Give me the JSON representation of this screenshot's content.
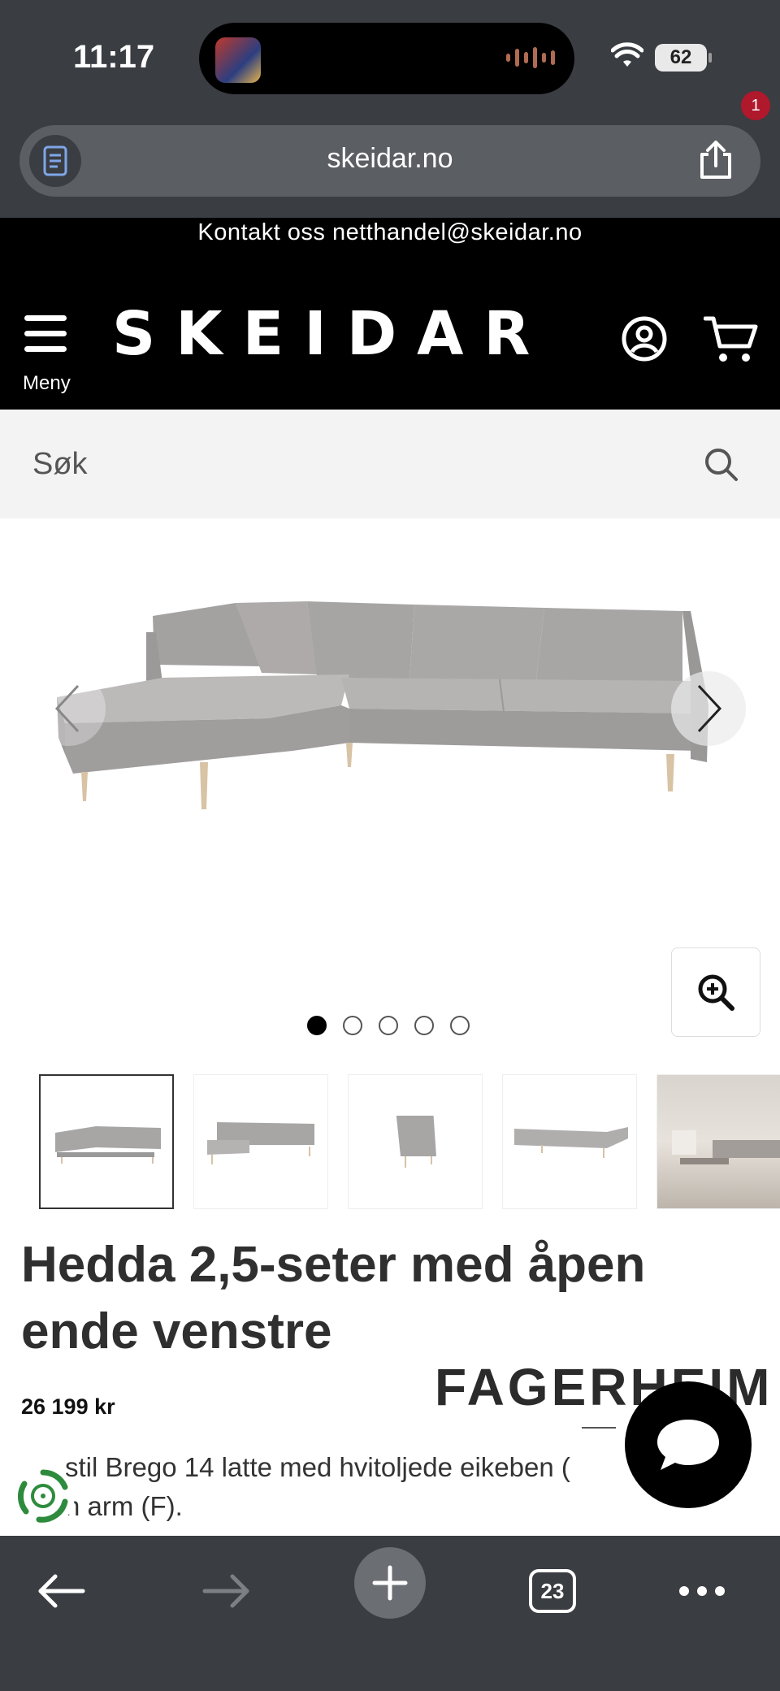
{
  "status": {
    "time": "11:17",
    "battery": "62"
  },
  "browser": {
    "url": "skeidar.no",
    "tabs_count": "23"
  },
  "header": {
    "contact_text": "Kontakt oss netthandel@skeidar.no",
    "menu_label": "Meny",
    "logo": "SKEIDAR",
    "cart_count": "1"
  },
  "search": {
    "placeholder": "Søk"
  },
  "gallery": {
    "image_count": 5,
    "active_index": 0
  },
  "product": {
    "title": "Hedda 2,5-seter med åpen ende venstre",
    "price": "26 199 kr",
    "brand": "FAGERHEIM",
    "description": "stil Brego 14 latte med hvitoljede eikeben (",
    "description2": "n arm (F)."
  },
  "colors": {
    "accent": "#b0182b",
    "header_bg": "#000000",
    "browser_chrome": "#3a3d42",
    "eco_green": "#2e8b3d"
  }
}
